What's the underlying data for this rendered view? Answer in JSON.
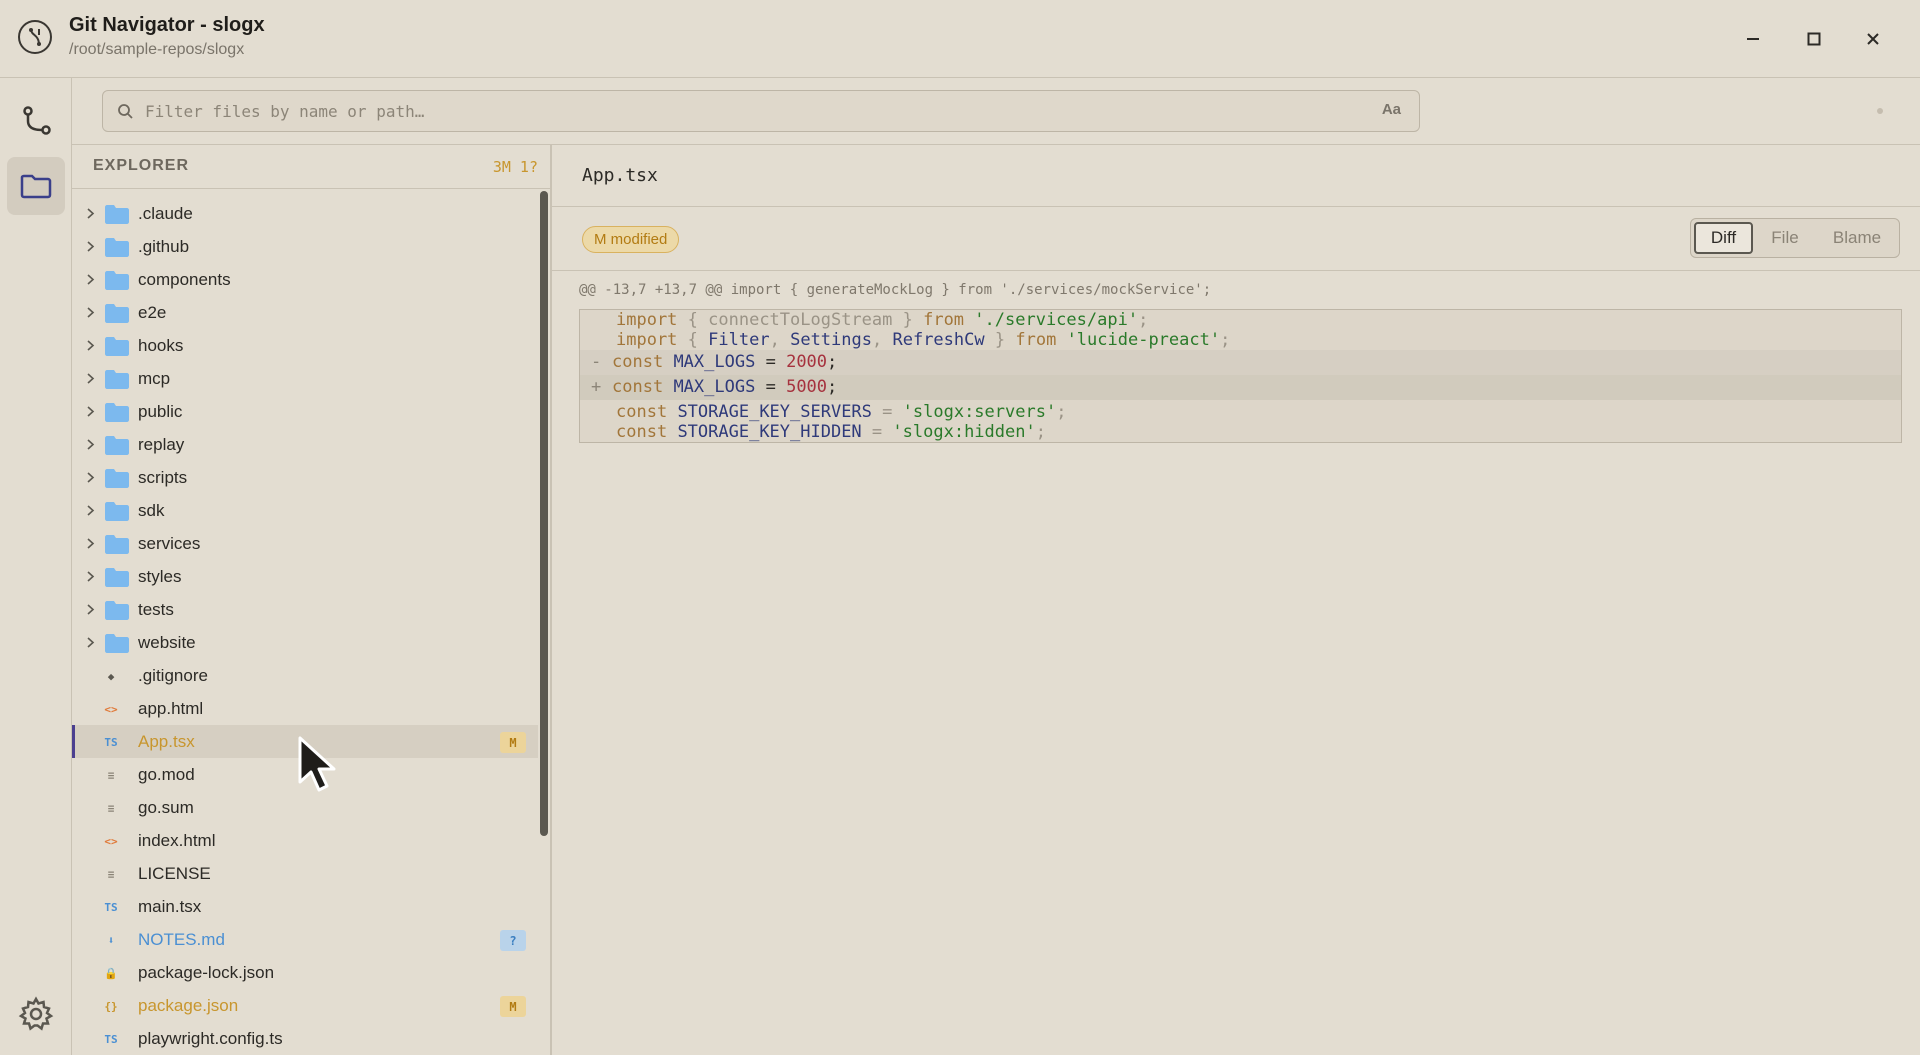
{
  "window": {
    "title": "Git Navigator - slogx",
    "path": "/root/sample-repos/slogx",
    "buttons": [
      "minimize",
      "maximize",
      "close"
    ]
  },
  "activity_bar": {
    "items": [
      {
        "icon": "git-branch-icon",
        "active": false
      },
      {
        "icon": "folder-icon",
        "active": true
      }
    ],
    "settings_icon": "gear-icon"
  },
  "search": {
    "placeholder": "Filter files by name or path…",
    "value": "",
    "case_toggle_label": "Aa"
  },
  "explorer": {
    "title": "EXPLORER",
    "counts": "3M 1?",
    "folders": [
      {
        "name": ".claude"
      },
      {
        "name": ".github"
      },
      {
        "name": "components"
      },
      {
        "name": "e2e"
      },
      {
        "name": "hooks"
      },
      {
        "name": "mcp"
      },
      {
        "name": "public"
      },
      {
        "name": "replay"
      },
      {
        "name": "scripts"
      },
      {
        "name": "sdk"
      },
      {
        "name": "services"
      },
      {
        "name": "styles"
      },
      {
        "name": "tests"
      },
      {
        "name": "website"
      }
    ],
    "files": [
      {
        "name": ".gitignore",
        "icon": "git-icon",
        "glyph": "◆",
        "icon_color": "#5b5850",
        "status": "",
        "badge": ""
      },
      {
        "name": "app.html",
        "icon": "html-icon",
        "glyph": "<>",
        "icon_color": "#e07a3a",
        "status": "",
        "badge": ""
      },
      {
        "name": "App.tsx",
        "icon": "typescript-icon",
        "glyph": "TS",
        "icon_color": "#4a8fd3",
        "status": "modified",
        "badge": "M",
        "selected": true
      },
      {
        "name": "go.mod",
        "icon": "text-file-icon",
        "glyph": "≡",
        "icon_color": "#8a8376",
        "status": "",
        "badge": ""
      },
      {
        "name": "go.sum",
        "icon": "text-file-icon",
        "glyph": "≡",
        "icon_color": "#8a8376",
        "status": "",
        "badge": ""
      },
      {
        "name": "index.html",
        "icon": "html-icon",
        "glyph": "<>",
        "icon_color": "#e07a3a",
        "status": "",
        "badge": ""
      },
      {
        "name": "LICENSE",
        "icon": "text-file-icon",
        "glyph": "≡",
        "icon_color": "#8a8376",
        "status": "",
        "badge": ""
      },
      {
        "name": "main.tsx",
        "icon": "typescript-icon",
        "glyph": "TS",
        "icon_color": "#4a8fd3",
        "status": "",
        "badge": ""
      },
      {
        "name": "NOTES.md",
        "icon": "markdown-icon",
        "glyph": "⬇",
        "icon_color": "#4a8fd3",
        "status": "untracked",
        "badge": "?"
      },
      {
        "name": "package-lock.json",
        "icon": "lock-icon",
        "glyph": "🔒",
        "icon_color": "#8a8376",
        "status": "",
        "badge": ""
      },
      {
        "name": "package.json",
        "icon": "json-icon",
        "glyph": "{}",
        "icon_color": "#c8962e",
        "status": "modified",
        "badge": "M"
      },
      {
        "name": "playwright.config.ts",
        "icon": "typescript-icon",
        "glyph": "TS",
        "icon_color": "#4a8fd3",
        "status": "",
        "badge": ""
      }
    ]
  },
  "main": {
    "file_name": "App.tsx",
    "status_label": "M modified",
    "view_tabs": [
      {
        "label": "Diff",
        "active": true
      },
      {
        "label": "File",
        "active": false
      },
      {
        "label": "Blame",
        "active": false
      }
    ],
    "hunk_header": "@@ -13,7 +13,7 @@ import { generateMockLog } from './services/mockService';",
    "diff_lines": [
      {
        "type": "context",
        "sign": " ",
        "text": "import { connectToLogStream } from './services/api';"
      },
      {
        "type": "context",
        "sign": " ",
        "text": "import { Filter, Settings, RefreshCw } from 'lucide-preact';"
      },
      {
        "type": "del",
        "sign": "-",
        "text": "const MAX_LOGS = 2000;"
      },
      {
        "type": "add",
        "sign": "+",
        "text": "const MAX_LOGS = 5000;"
      },
      {
        "type": "context",
        "sign": " ",
        "text": "const STORAGE_KEY_SERVERS = 'slogx:servers';"
      },
      {
        "type": "context",
        "sign": " ",
        "text": "const STORAGE_KEY_HIDDEN = 'slogx:hidden';"
      }
    ]
  },
  "colors": {
    "background": "#e3ddd1",
    "modified": "#c8962e",
    "untracked": "#4a8fd3",
    "selection_bar": "#4b3f8f",
    "folder": "#7cb9ee"
  }
}
